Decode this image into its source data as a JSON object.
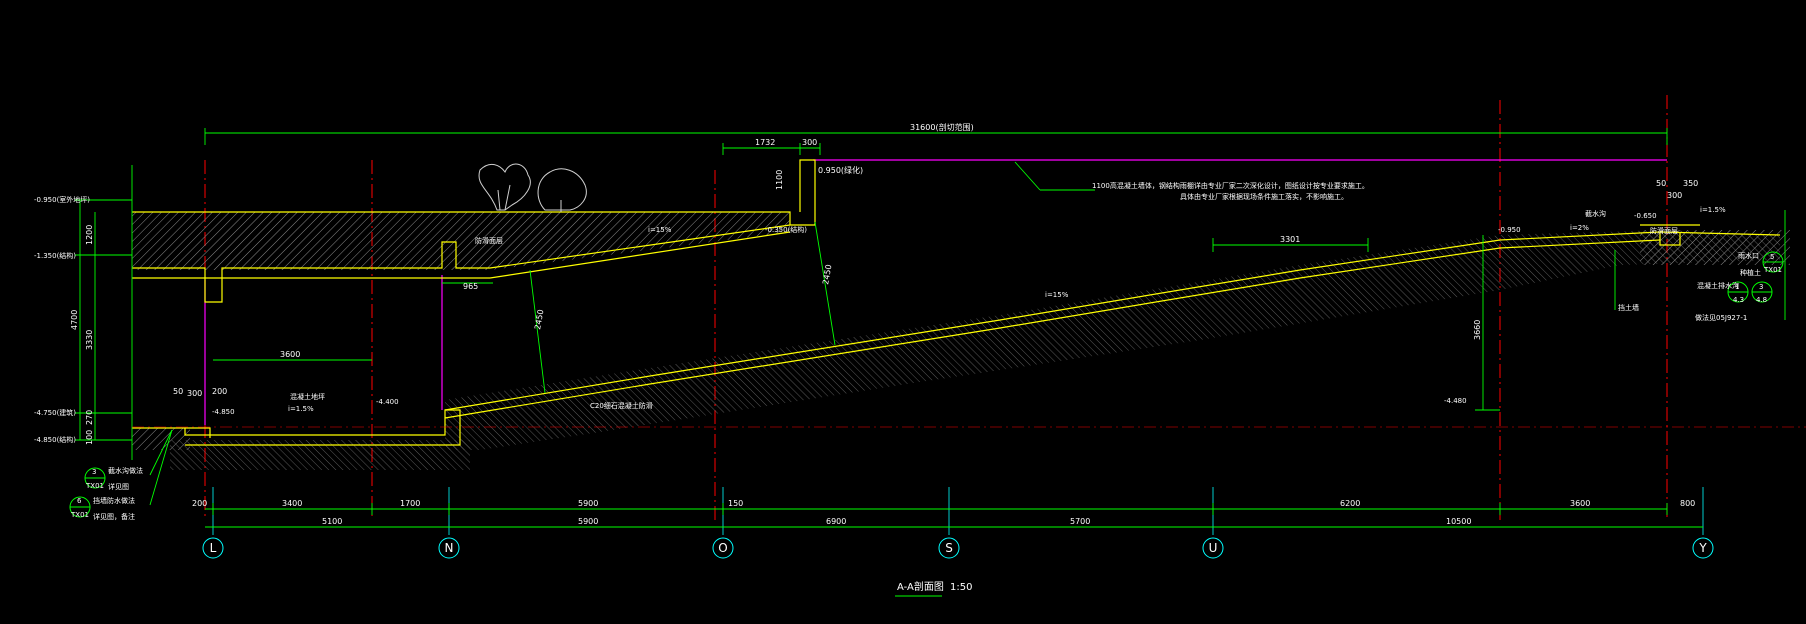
{
  "drawing": {
    "title": "A-A剖面图",
    "scale": "1:50",
    "accent_colors": {
      "dimension": "#00ff00",
      "axis": "#00ffff",
      "centerline": "#ff0000",
      "magenta": "#ff00ff",
      "structure": "#ffff00",
      "hatch": "#9a9a9a"
    }
  },
  "axes": [
    "L",
    "N",
    "O",
    "S",
    "U",
    "Y"
  ],
  "top_dimension": "31600(剖切范围)",
  "upper_dims": {
    "d1732": "1732",
    "d300": "300",
    "d1100": "1100",
    "d0950": "0.950(绿化)",
    "d50": "50",
    "d350": "350",
    "d300b": "300"
  },
  "left_levels": {
    "l1": "-0.950(室外地坪)",
    "l2": "-1.350(结构)",
    "l3": "-4.750(建筑)",
    "l4": "-4.850(结构)"
  },
  "left_dims": {
    "d1200": "1200",
    "d4700": "4700",
    "d3330": "3330",
    "d270": "270",
    "d100": "100"
  },
  "inner_dims": {
    "d3600": "3600",
    "d965": "965",
    "d3301": "3301",
    "d3660": "3660",
    "d50a": "50",
    "d300a": "300",
    "d200a": "200",
    "d2450a": "2450",
    "d2450b": "2450"
  },
  "bottom_row1": [
    "200",
    "3400",
    "1700",
    "5900",
    "150",
    "6200",
    "3600",
    "800"
  ],
  "bottom_row2": [
    "5100",
    "5900",
    "6900",
    "5700",
    "10500"
  ],
  "annotations": {
    "note1": "1100高混凝土墙体，钢结构雨棚详由专业厂家二次深化设计，图纸设计按专业要求施工。",
    "note2": "具体由专业厂家根据现场条件施工落实，不影响施工。",
    "lv_m4480": "-4.480",
    "lv_m4400": "-4.400",
    "lv_m0350": "-0.350(结构)",
    "lv_m0950r": "-0.950",
    "lv_m0650": "-0.650",
    "lv_m4850b": "-4.850",
    "slope1": "i=15%",
    "slope2": "i=15%",
    "slope_small": "i=1.5%",
    "slope_r1": "i=2%",
    "slope_r2": "i=1.5%",
    "drain_left": "混凝土地坪",
    "drain_left2": "防滑面层",
    "ramp_note": "C20细石混凝土防滑",
    "r_label1": "截水沟",
    "r_label2": "防滑面层",
    "r_label3": "混凝土排水沟",
    "r_label4": "做法见05J927-1",
    "r_label5": "种植土",
    "r_label6": "挡土墙",
    "r_label7": "雨水口"
  },
  "callouts": {
    "c1_top": "3",
    "c1_bot": "TX01",
    "c1_text": "截水沟做法",
    "c1_text2": "详见图",
    "c2_top": "6",
    "c2_bot": "TX01",
    "c2_text": "挡墙防水做法",
    "c2_text2": "详见图，备注",
    "c3_top": "1",
    "c3_bot": "4.3",
    "c4_top": "3",
    "c4_bot": "4.8",
    "c5_top": "5",
    "c5_bot": "TX01"
  }
}
